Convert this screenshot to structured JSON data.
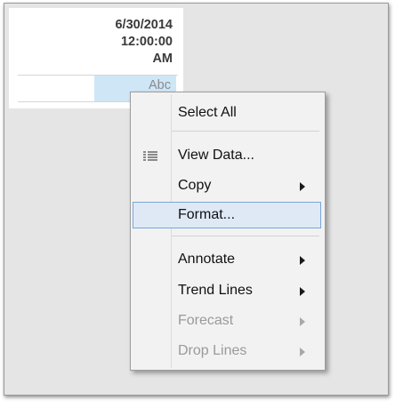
{
  "cell": {
    "date_line1": "6/30/2014",
    "date_line2": "12:00:00",
    "date_line3": "AM",
    "abc": "Abc"
  },
  "colors": {
    "selected_cell": "#cfe6f7",
    "menu_highlight": "#dfe9f6",
    "menu_highlight_border": "#7aa6d9",
    "disabled_text": "#9a9a9a"
  },
  "context_menu": {
    "items": [
      {
        "label": "Select All",
        "enabled": true,
        "submenu": false
      },
      {
        "label": "View Data...",
        "enabled": true,
        "submenu": false,
        "icon": "table-icon"
      },
      {
        "label": "Copy",
        "enabled": true,
        "submenu": true
      },
      {
        "label": "Format...",
        "enabled": true,
        "submenu": false,
        "highlighted": true
      },
      {
        "label": "Annotate",
        "enabled": true,
        "submenu": true
      },
      {
        "label": "Trend Lines",
        "enabled": true,
        "submenu": true
      },
      {
        "label": "Forecast",
        "enabled": false,
        "submenu": true
      },
      {
        "label": "Drop Lines",
        "enabled": false,
        "submenu": true
      }
    ]
  }
}
